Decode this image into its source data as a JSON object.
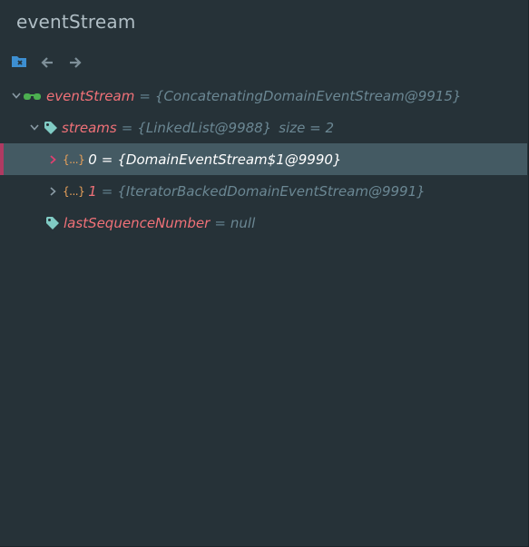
{
  "title": "eventStream",
  "toolbar": {
    "icons": [
      "folder-close-icon",
      "back-arrow-icon",
      "forward-arrow-icon"
    ]
  },
  "colors": {
    "background": "#263238",
    "selection": "#445a63",
    "selection_marker": "#b03a62",
    "name": "#f07178",
    "value": "#6b8793",
    "brace_icon": "#e8a15a",
    "tag_icon": "#80cbc4",
    "glasses_icon": "#4caf50"
  },
  "tree": {
    "root": {
      "name": "eventStream",
      "eq": "=",
      "value": "{ConcatenatingDomainEventStream@9915}",
      "icon": "watch-glasses-icon",
      "expanded": true
    },
    "streams": {
      "name": "streams",
      "eq": "=",
      "value": "{LinkedList@9988}",
      "size": "size = 2",
      "icon": "field-tag-icon",
      "expanded": true
    },
    "items": [
      {
        "name": "0",
        "eq": "=",
        "value": "{DomainEventStream$1@9990}",
        "braces": "{...}",
        "selected": true
      },
      {
        "name": "1",
        "eq": "=",
        "value": "{IteratorBackedDomainEventStream@9991}",
        "braces": "{...}",
        "selected": false
      }
    ],
    "lastSeq": {
      "name": "lastSequenceNumber",
      "eq": "=",
      "value": "null",
      "icon": "field-tag-icon"
    }
  }
}
